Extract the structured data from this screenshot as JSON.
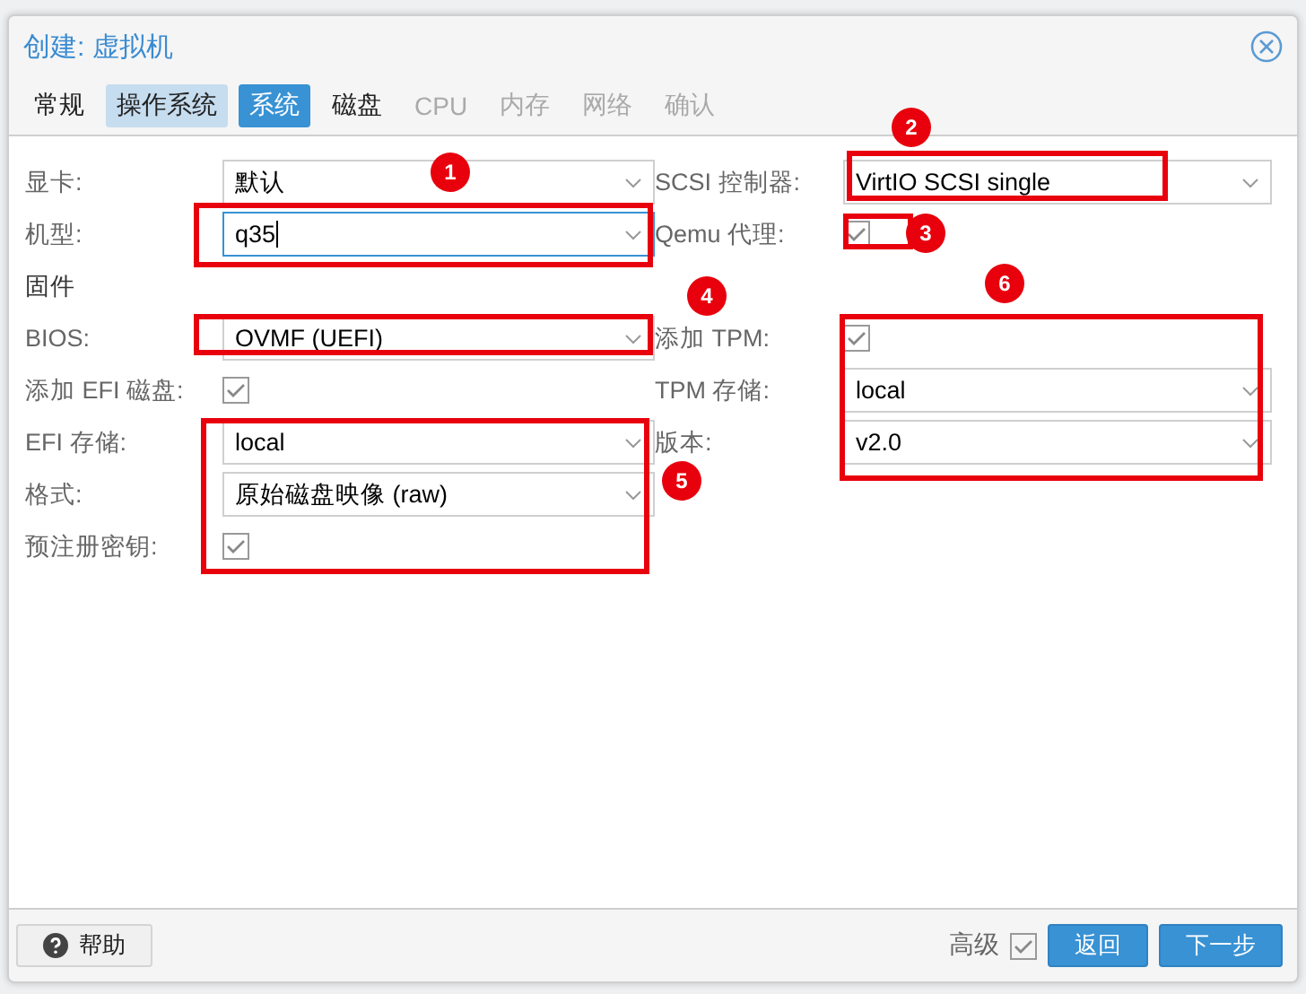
{
  "window": {
    "title": "创建: 虚拟机"
  },
  "tabs": [
    {
      "label": "常规",
      "selected": false,
      "highlighted": false,
      "disabled": false
    },
    {
      "label": "操作系统",
      "selected": false,
      "highlighted": true,
      "disabled": false
    },
    {
      "label": "系统",
      "selected": true,
      "highlighted": false,
      "disabled": false
    },
    {
      "label": "磁盘",
      "selected": false,
      "highlighted": false,
      "disabled": false
    },
    {
      "label": "CPU",
      "selected": false,
      "highlighted": false,
      "disabled": true
    },
    {
      "label": "内存",
      "selected": false,
      "highlighted": false,
      "disabled": true
    },
    {
      "label": "网络",
      "selected": false,
      "highlighted": false,
      "disabled": true
    },
    {
      "label": "确认",
      "selected": false,
      "highlighted": false,
      "disabled": true
    }
  ],
  "left_fields": [
    {
      "kind": "select",
      "label": "显卡:",
      "value": "默认",
      "focused": false
    },
    {
      "kind": "select",
      "label": "机型:",
      "value": "q35",
      "focused": true
    },
    {
      "kind": "heading",
      "label": "固件"
    },
    {
      "kind": "select",
      "label": "BIOS:",
      "value": "OVMF (UEFI)",
      "focused": false
    },
    {
      "kind": "checkbox",
      "label": "添加 EFI 磁盘:",
      "checked": true
    },
    {
      "kind": "select",
      "label": "EFI 存储:",
      "value": "local",
      "focused": false
    },
    {
      "kind": "select",
      "label": "格式:",
      "value": "原始磁盘映像 (raw)",
      "focused": false
    },
    {
      "kind": "checkbox",
      "label": "预注册密钥:",
      "checked": true
    }
  ],
  "right_fields": [
    {
      "kind": "select",
      "label": "SCSI 控制器:",
      "value": "VirtIO SCSI single",
      "focused": false
    },
    {
      "kind": "checkbox",
      "label": "Qemu 代理:",
      "checked": true
    },
    {
      "kind": "spacer"
    },
    {
      "kind": "checkbox",
      "label": "添加 TPM:",
      "checked": true
    },
    {
      "kind": "select",
      "label": "TPM 存储:",
      "value": "local",
      "focused": false
    },
    {
      "kind": "select",
      "label": "版本:",
      "value": "v2.0",
      "focused": false
    }
  ],
  "markers": [
    "1",
    "2",
    "3",
    "4",
    "5",
    "6"
  ],
  "footer": {
    "help_button": "帮助",
    "advanced": {
      "label": "高级",
      "checked": true
    },
    "buttons": [
      "返回",
      "下一步"
    ]
  }
}
